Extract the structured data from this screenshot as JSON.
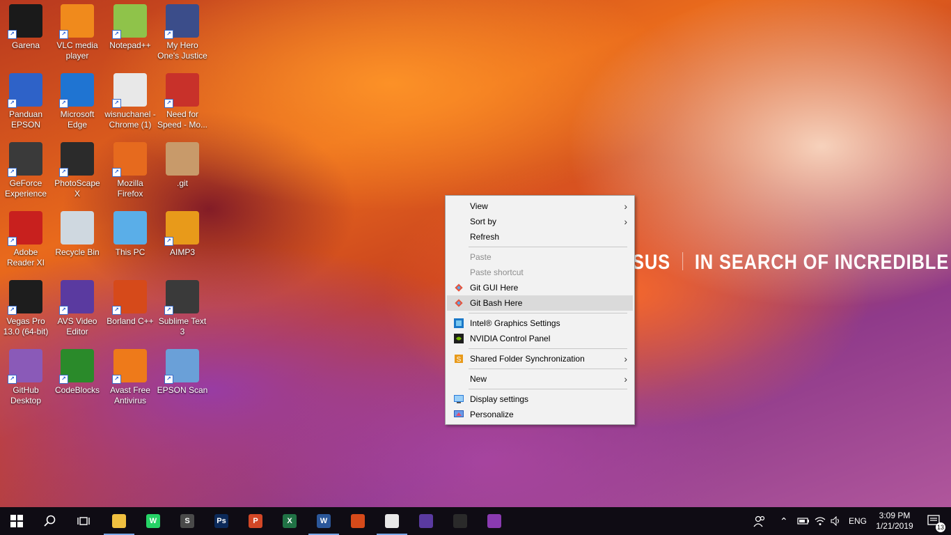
{
  "desktop": {
    "icons": [
      {
        "label": "Garena",
        "icon": "garena-icon",
        "color": "#1a1a1a"
      },
      {
        "label": "VLC media player",
        "icon": "vlc-icon",
        "color": "#f08a1c"
      },
      {
        "label": "Notepad++",
        "icon": "notepad-plus-plus-icon",
        "color": "#8fc34a"
      },
      {
        "label": "My Hero One's Justice",
        "icon": "game-icon",
        "color": "#3b4d8a"
      },
      {
        "label": "Panduan EPSON",
        "icon": "epson-guide-icon",
        "color": "#2e62c8"
      },
      {
        "label": "Microsoft Edge",
        "icon": "edge-icon",
        "color": "#1f74d2"
      },
      {
        "label": "wisnuchanel - Chrome (1)",
        "icon": "chrome-icon",
        "color": "#e8e8e8"
      },
      {
        "label": "Need for Speed - Mo...",
        "icon": "nfs-icon",
        "color": "#c8312a"
      },
      {
        "label": "GeForce Experience",
        "icon": "geforce-icon",
        "color": "#3a3a3a"
      },
      {
        "label": "PhotoScape X",
        "icon": "photoscape-icon",
        "color": "#2b2b2b"
      },
      {
        "label": "Mozilla Firefox",
        "icon": "firefox-icon",
        "color": "#e66a1e"
      },
      {
        "label": ".git",
        "icon": "folder-icon",
        "color": "#c89a6a"
      },
      {
        "label": "Adobe Reader XI",
        "icon": "adobe-reader-icon",
        "color": "#c8201e"
      },
      {
        "label": "Recycle Bin",
        "icon": "recycle-bin-icon",
        "color": "#cfd8e0"
      },
      {
        "label": "This PC",
        "icon": "this-pc-icon",
        "color": "#5aaee8"
      },
      {
        "label": "AIMP3",
        "icon": "aimp-icon",
        "color": "#e89a1a"
      },
      {
        "label": "Vegas Pro 13.0 (64-bit)",
        "icon": "vegas-pro-icon",
        "color": "#1d1d1d"
      },
      {
        "label": "AVS Video Editor",
        "icon": "avs-video-icon",
        "color": "#5a3aa0"
      },
      {
        "label": "Borland C++",
        "icon": "borland-icon",
        "color": "#d64a1a"
      },
      {
        "label": "Sublime Text 3",
        "icon": "sublime-icon",
        "color": "#3a3a3a"
      },
      {
        "label": "GitHub Desktop",
        "icon": "github-icon",
        "color": "#8a5ab8"
      },
      {
        "label": "CodeBlocks",
        "icon": "codeblocks-icon",
        "color": "#2a8a2a"
      },
      {
        "label": "Avast Free Antivirus",
        "icon": "avast-icon",
        "color": "#ee7a1a"
      },
      {
        "label": "EPSON Scan",
        "icon": "epson-scan-icon",
        "color": "#6aa0d8"
      }
    ],
    "brand_logo": "SUS",
    "brand_tagline": "IN SEARCH OF INCREDIBLE"
  },
  "context_menu": {
    "view": "View",
    "sort_by": "Sort by",
    "refresh": "Refresh",
    "paste": "Paste",
    "paste_shortcut": "Paste shortcut",
    "git_gui": "Git GUI Here",
    "git_bash": "Git Bash Here",
    "intel_graphics": "Intel® Graphics Settings",
    "nvidia": "NVIDIA Control Panel",
    "shared_folder": "Shared Folder Synchronization",
    "new": "New",
    "display_settings": "Display settings",
    "personalize": "Personalize"
  },
  "taskbar": {
    "apps": [
      {
        "icon": "file-explorer-icon",
        "color": "#f0c040",
        "text": "",
        "active": true
      },
      {
        "icon": "whatsapp-icon",
        "color": "#25d366",
        "text": "W",
        "active": false
      },
      {
        "icon": "sublime-text-icon",
        "color": "#4a4a4a",
        "text": "S",
        "active": false
      },
      {
        "icon": "photoshop-icon",
        "color": "#0c2a5a",
        "text": "Ps",
        "active": false
      },
      {
        "icon": "powerpoint-icon",
        "color": "#d24726",
        "text": "P",
        "active": false
      },
      {
        "icon": "excel-icon",
        "color": "#207245",
        "text": "X",
        "active": false
      },
      {
        "icon": "word-icon",
        "color": "#2b579a",
        "text": "W",
        "active": true
      },
      {
        "icon": "borland-taskbar-icon",
        "color": "#d64a1a",
        "text": "",
        "active": false
      },
      {
        "icon": "chrome-taskbar-icon",
        "color": "#e8e8e8",
        "text": "",
        "active": true
      },
      {
        "icon": "avs-taskbar-icon",
        "color": "#5a3aa0",
        "text": "",
        "active": false
      },
      {
        "icon": "vegas-taskbar-icon",
        "color": "#2a2a2a",
        "text": "",
        "active": false
      },
      {
        "icon": "winrar-icon",
        "color": "#8a3ab0",
        "text": "",
        "active": false
      }
    ],
    "language": "ENG",
    "time": "3:09 PM",
    "date": "1/21/2019",
    "notification_count": "13"
  }
}
